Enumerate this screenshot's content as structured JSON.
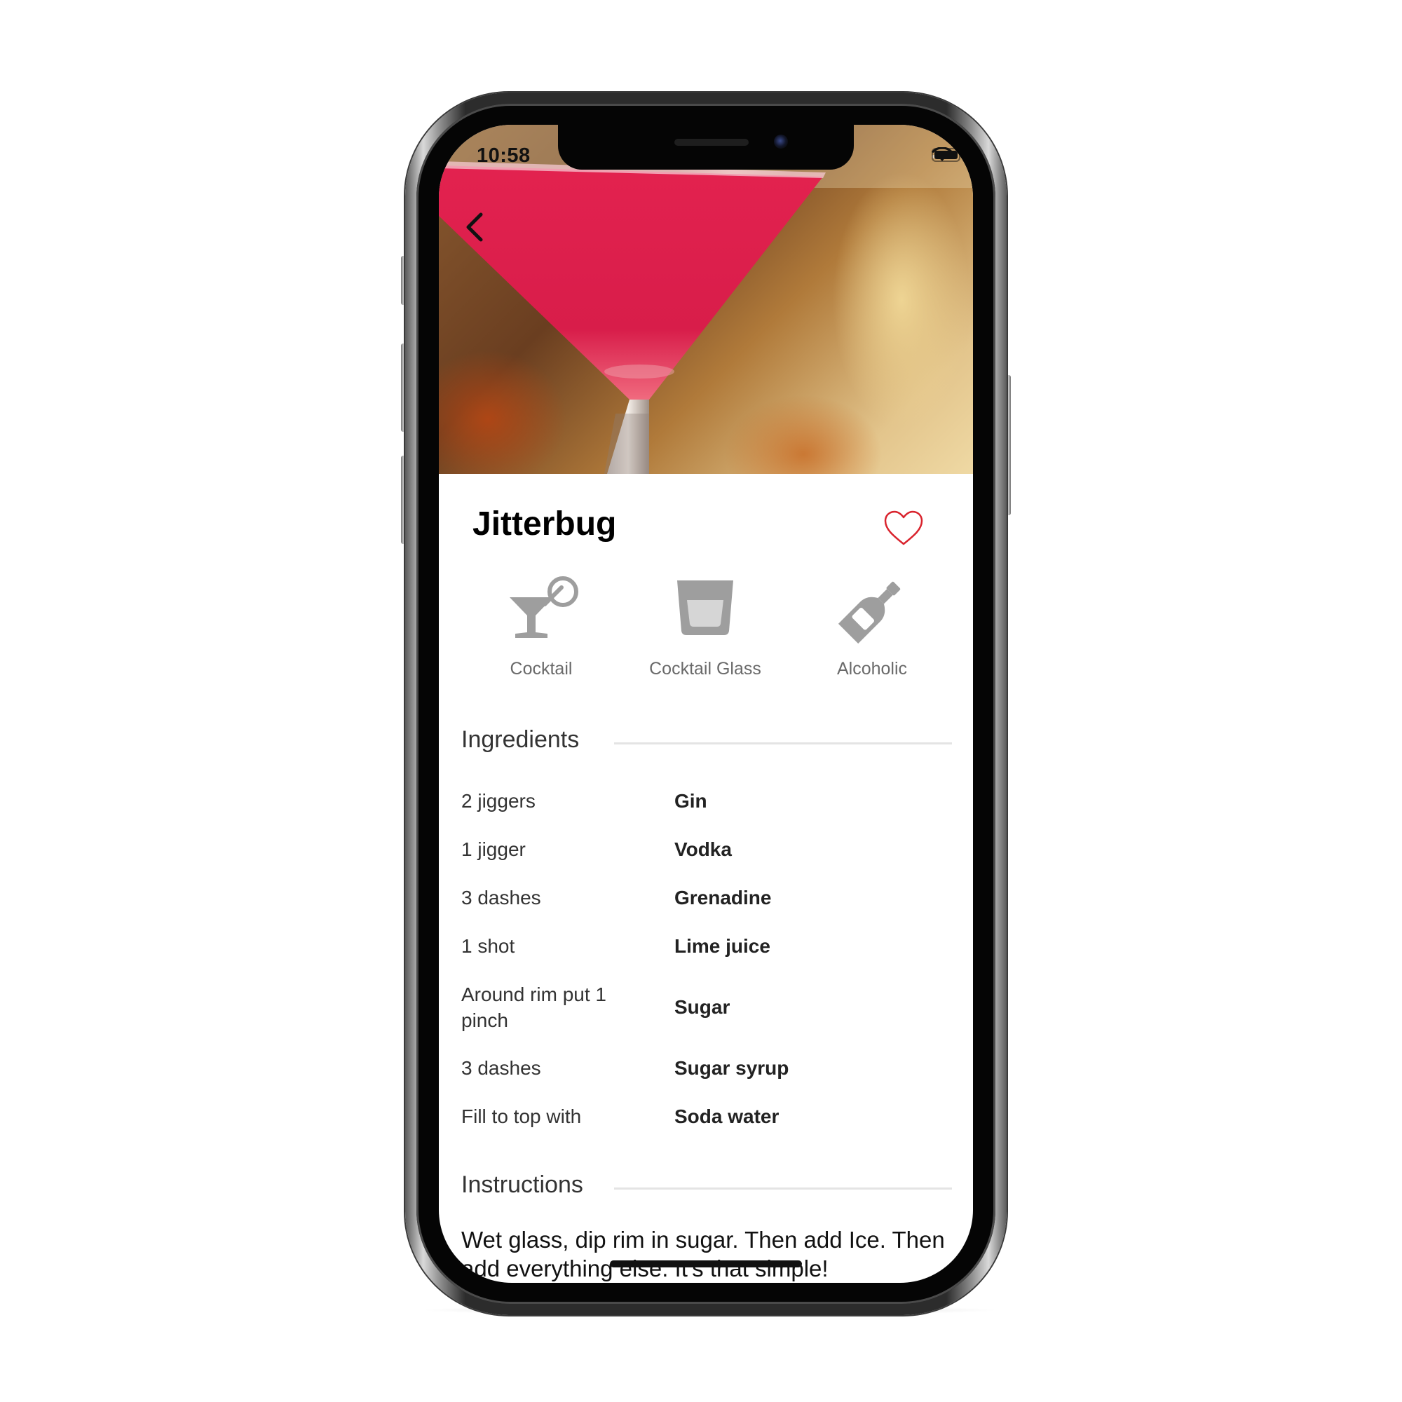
{
  "status_bar": {
    "time": "10:58"
  },
  "hero": {
    "image": "cocktail-photo",
    "accent_color": "#e3224f"
  },
  "drink": {
    "name": "Jitterbug",
    "favorite": false
  },
  "attributes": [
    {
      "icon": "cocktail-icon",
      "label": "Cocktail"
    },
    {
      "icon": "glass-icon",
      "label": "Cocktail Glass"
    },
    {
      "icon": "bottle-icon",
      "label": "Alcoholic"
    }
  ],
  "ingredients": {
    "title": "Ingredients",
    "items": [
      {
        "measure": "2 jiggers",
        "name": "Gin"
      },
      {
        "measure": "1 jigger",
        "name": "Vodka"
      },
      {
        "measure": "3 dashes",
        "name": "Grenadine"
      },
      {
        "measure": "1 shot",
        "name": "Lime juice"
      },
      {
        "measure": "Around rim put 1 pinch",
        "name": "Sugar"
      },
      {
        "measure": "3 dashes",
        "name": "Sugar syrup"
      },
      {
        "measure": "Fill to top with",
        "name": "Soda water"
      }
    ]
  },
  "instructions": {
    "title": "Instructions",
    "text": "Wet glass, dip rim in sugar. Then add Ice. Then add everything else. It's that simple!"
  },
  "colors": {
    "heart": "#d9232d",
    "icon_gray": "#9e9e9e",
    "rule": "#e4e4e4"
  }
}
